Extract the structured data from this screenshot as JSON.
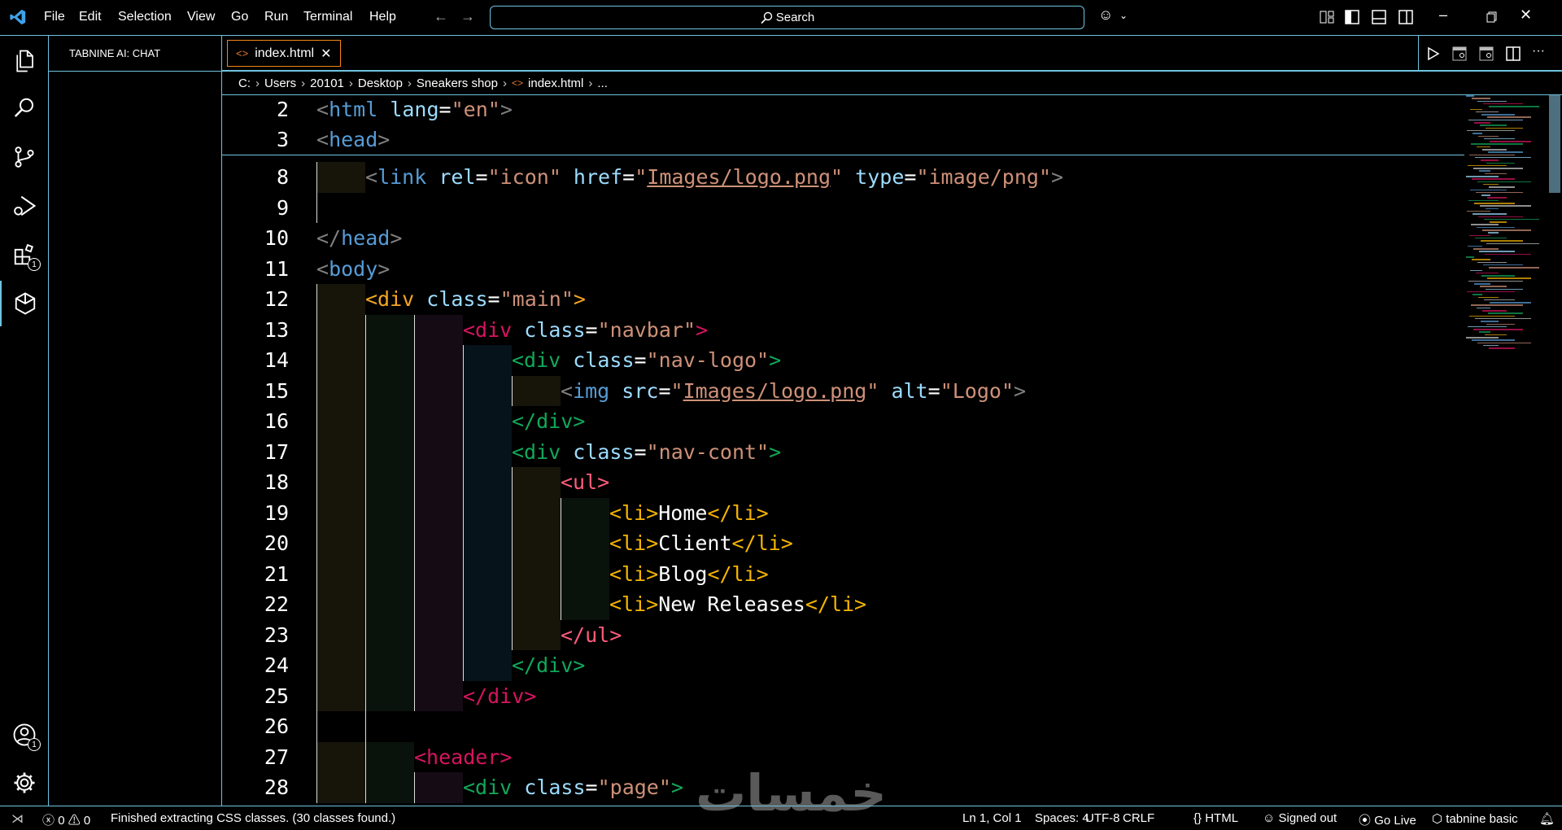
{
  "titlebar": {
    "menu": [
      "File",
      "Edit",
      "Selection",
      "View",
      "Go",
      "Run",
      "Terminal",
      "Help"
    ],
    "search_label": "Search"
  },
  "activity_bar": {
    "items": [
      {
        "name": "explorer",
        "icon": "files-icon"
      },
      {
        "name": "search",
        "icon": "search-icon"
      },
      {
        "name": "source-control",
        "icon": "source-control-icon"
      },
      {
        "name": "run-debug",
        "icon": "run-debug-icon"
      },
      {
        "name": "extensions",
        "icon": "extensions-icon",
        "badge": "1"
      },
      {
        "name": "tabnine",
        "icon": "tabnine-icon",
        "active": true
      }
    ],
    "accounts_badge": "1"
  },
  "side_panel": {
    "title": "TABNINE AI: CHAT"
  },
  "tabs": [
    {
      "label": "index.html",
      "active": true
    }
  ],
  "breadcrumb": [
    "C:",
    "Users",
    "20101",
    "Desktop",
    "Sneakers shop",
    "index.html",
    "..."
  ],
  "editor": {
    "sticky": [
      {
        "n": "2",
        "indent": 0,
        "tokens": [
          [
            "#808080",
            "<"
          ],
          [
            "#569cd6",
            "html"
          ],
          [
            "attr",
            " lang"
          ],
          [
            "eq",
            "="
          ],
          [
            "str",
            "\"en\""
          ],
          [
            "#808080",
            ">"
          ]
        ]
      },
      {
        "n": "3",
        "indent": 0,
        "tokens": [
          [
            "#808080",
            "<"
          ],
          [
            "#569cd6",
            "head"
          ],
          [
            "#808080",
            ">"
          ]
        ]
      }
    ],
    "lines": [
      {
        "n": "8",
        "indent": 1,
        "tokens": [
          [
            "#808080",
            "<"
          ],
          [
            "#569cd6",
            "link"
          ],
          [
            "attr",
            " rel"
          ],
          [
            "eq",
            "="
          ],
          [
            "str",
            "\"icon\""
          ],
          [
            "attr",
            " href"
          ],
          [
            "eq",
            "="
          ],
          [
            "str",
            "\""
          ],
          [
            "strlink",
            "Images/logo.png"
          ],
          [
            "str",
            "\""
          ],
          [
            "attr",
            " type"
          ],
          [
            "eq",
            "="
          ],
          [
            "str",
            "\"image/png\""
          ],
          [
            "#808080",
            ">"
          ]
        ]
      },
      {
        "n": "9",
        "indent": 1,
        "guideOnly": true,
        "tokens": []
      },
      {
        "n": "10",
        "indent": 0,
        "tokens": [
          [
            "#808080",
            "</"
          ],
          [
            "#569cd6",
            "head"
          ],
          [
            "#808080",
            ">"
          ]
        ]
      },
      {
        "n": "11",
        "indent": 0,
        "tokens": [
          [
            "#808080",
            "<"
          ],
          [
            "#569cd6",
            "body"
          ],
          [
            "#808080",
            ">"
          ]
        ]
      },
      {
        "n": "12",
        "indent": 1,
        "tokens": [
          [
            "#f5a623",
            "<div"
          ],
          [
            "attr",
            " class"
          ],
          [
            "eq",
            "="
          ],
          [
            "str",
            "\"main\""
          ],
          [
            "#f5a623",
            ">"
          ]
        ]
      },
      {
        "n": "13",
        "indent": 3,
        "tokens": [
          [
            "#d6145f",
            "<div"
          ],
          [
            "attr",
            " class"
          ],
          [
            "eq",
            "="
          ],
          [
            "str",
            "\"navbar\""
          ],
          [
            "#d6145f",
            ">"
          ]
        ]
      },
      {
        "n": "14",
        "indent": 4,
        "tokens": [
          [
            "#11a85a",
            "<div"
          ],
          [
            "attr",
            " class"
          ],
          [
            "eq",
            "="
          ],
          [
            "str",
            "\"nav-logo\""
          ],
          [
            "#11a85a",
            ">"
          ]
        ]
      },
      {
        "n": "15",
        "indent": 5,
        "tokens": [
          [
            "#808080",
            "<"
          ],
          [
            "#569cd6",
            "img"
          ],
          [
            "attr",
            " src"
          ],
          [
            "eq",
            "="
          ],
          [
            "str",
            "\""
          ],
          [
            "strlink",
            "Images/logo.png"
          ],
          [
            "str",
            "\""
          ],
          [
            "attr",
            " alt"
          ],
          [
            "eq",
            "="
          ],
          [
            "str",
            "\"Logo\""
          ],
          [
            "#808080",
            ">"
          ]
        ]
      },
      {
        "n": "16",
        "indent": 4,
        "tokens": [
          [
            "#11a85a",
            "</div>"
          ]
        ]
      },
      {
        "n": "17",
        "indent": 4,
        "tokens": [
          [
            "#11a85a",
            "<div"
          ],
          [
            "attr",
            " class"
          ],
          [
            "eq",
            "="
          ],
          [
            "str",
            "\"nav-cont\""
          ],
          [
            "#11a85a",
            ">"
          ]
        ]
      },
      {
        "n": "18",
        "indent": 5,
        "tokens": [
          [
            "#ff5c7a",
            "<ul>"
          ]
        ]
      },
      {
        "n": "19",
        "indent": 6,
        "tokens": [
          [
            "#f5b400",
            "<li>"
          ],
          [
            "txt",
            "Home"
          ],
          [
            "#f5b400",
            "</li>"
          ]
        ]
      },
      {
        "n": "20",
        "indent": 6,
        "tokens": [
          [
            "#f5b400",
            "<li>"
          ],
          [
            "txt",
            "Client"
          ],
          [
            "#f5b400",
            "</li>"
          ]
        ]
      },
      {
        "n": "21",
        "indent": 6,
        "tokens": [
          [
            "#f5b400",
            "<li>"
          ],
          [
            "txt",
            "Blog"
          ],
          [
            "#f5b400",
            "</li>"
          ]
        ]
      },
      {
        "n": "22",
        "indent": 6,
        "tokens": [
          [
            "#f5b400",
            "<li>"
          ],
          [
            "txt",
            "New Releases"
          ],
          [
            "#f5b400",
            "</li>"
          ]
        ]
      },
      {
        "n": "23",
        "indent": 5,
        "tokens": [
          [
            "#ff5c7a",
            "</ul>"
          ]
        ]
      },
      {
        "n": "24",
        "indent": 4,
        "tokens": [
          [
            "#11a85a",
            "</div>"
          ]
        ]
      },
      {
        "n": "25",
        "indent": 3,
        "tokens": [
          [
            "#d6145f",
            "</div>"
          ]
        ]
      },
      {
        "n": "26",
        "indent": 2,
        "guideOnly": true,
        "tokens": []
      },
      {
        "n": "27",
        "indent": 2,
        "tokens": [
          [
            "#d6145f",
            "<header>"
          ]
        ]
      },
      {
        "n": "28",
        "indent": 3,
        "tokens": [
          [
            "#11a85a",
            "<div"
          ],
          [
            "attr",
            " class"
          ],
          [
            "eq",
            "="
          ],
          [
            "str",
            "\"page\""
          ],
          [
            "#11a85a",
            ">"
          ]
        ]
      }
    ],
    "indent_colors": [
      "#17150a",
      "#0a120c",
      "#150b15",
      "#06131a",
      "#17150a",
      "#0a120c"
    ]
  },
  "statusbar": {
    "errors": "0",
    "warnings": "0",
    "message": "Finished extracting CSS classes. (30 classes found.)",
    "position": "Ln 1, Col 1",
    "spaces": "Spaces: 4",
    "encoding": "UTF-8",
    "eol": "CRLF",
    "language": "HTML",
    "copilot": "Signed out",
    "golive": "Go Live",
    "tabnine": "tabnine basic"
  },
  "watermark": "خمسات",
  "colors": {
    "border": "#6fc3df",
    "tab_border": "#f38518",
    "html_icon": "#e37933"
  }
}
